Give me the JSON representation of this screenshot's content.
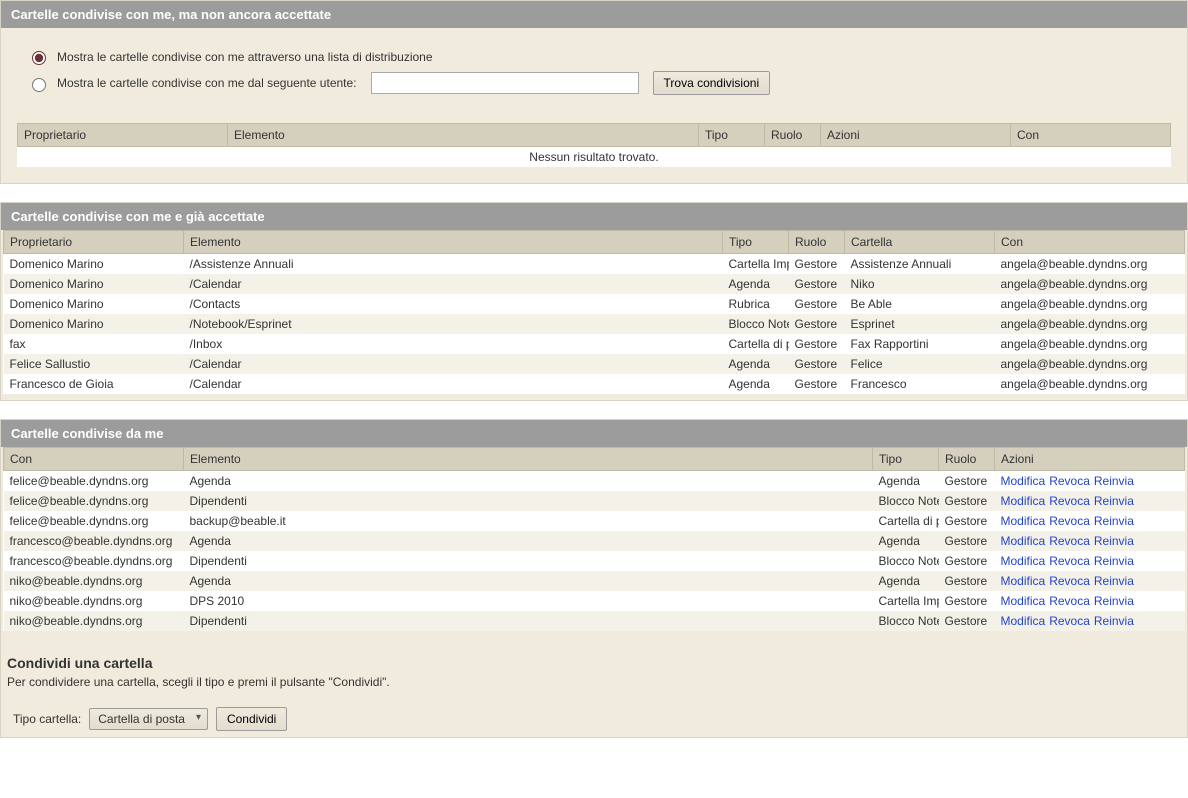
{
  "section1": {
    "title": "Cartelle condivise con me, ma non ancora accettate",
    "radio_dist_label": "Mostra le cartelle condivise con me attraverso una lista di distribuzione",
    "radio_user_label": "Mostra le cartelle condivise con me dal seguente utente:",
    "user_input_value": "",
    "find_button": "Trova condivisioni",
    "columns": {
      "proprietario": "Proprietario",
      "elemento": "Elemento",
      "tipo": "Tipo",
      "ruolo": "Ruolo",
      "azioni": "Azioni",
      "con": "Con"
    },
    "no_results": "Nessun risultato trovato."
  },
  "section2": {
    "title": "Cartelle condivise con me e già accettate",
    "columns": {
      "proprietario": "Proprietario",
      "elemento": "Elemento",
      "tipo": "Tipo",
      "ruolo": "Ruolo",
      "cartella": "Cartella",
      "con": "Con"
    },
    "rows": [
      {
        "proprietario": "Domenico Marino",
        "elemento": "/Assistenze Annuali",
        "tipo": "Cartella Imp",
        "ruolo": "Gestore",
        "cartella": "Assistenze Annuali",
        "con": "angela@beable.dyndns.org"
      },
      {
        "proprietario": "Domenico Marino",
        "elemento": "/Calendar",
        "tipo": "Agenda",
        "ruolo": "Gestore",
        "cartella": "Niko",
        "con": "angela@beable.dyndns.org"
      },
      {
        "proprietario": "Domenico Marino",
        "elemento": "/Contacts",
        "tipo": "Rubrica",
        "ruolo": "Gestore",
        "cartella": "Be Able",
        "con": "angela@beable.dyndns.org"
      },
      {
        "proprietario": "Domenico Marino",
        "elemento": "/Notebook/Esprinet",
        "tipo": "Blocco Note",
        "ruolo": "Gestore",
        "cartella": "Esprinet",
        "con": "angela@beable.dyndns.org"
      },
      {
        "proprietario": "fax",
        "elemento": "/Inbox",
        "tipo": "Cartella di p",
        "ruolo": "Gestore",
        "cartella": "Fax Rapportini",
        "con": "angela@beable.dyndns.org"
      },
      {
        "proprietario": "Felice Sallustio",
        "elemento": "/Calendar",
        "tipo": "Agenda",
        "ruolo": "Gestore",
        "cartella": "Felice",
        "con": "angela@beable.dyndns.org"
      },
      {
        "proprietario": "Francesco de Gioia",
        "elemento": "/Calendar",
        "tipo": "Agenda",
        "ruolo": "Gestore",
        "cartella": "Francesco",
        "con": "angela@beable.dyndns.org"
      }
    ]
  },
  "section3": {
    "title": "Cartelle condivise da me",
    "columns": {
      "con": "Con",
      "elemento": "Elemento",
      "tipo": "Tipo",
      "ruolo": "Ruolo",
      "azioni": "Azioni"
    },
    "actions": {
      "modifica": "Modifica",
      "revoca": "Revoca",
      "reinvia": "Reinvia"
    },
    "rows": [
      {
        "con": "felice@beable.dyndns.org",
        "elemento": "Agenda",
        "tipo": "Agenda",
        "ruolo": "Gestore"
      },
      {
        "con": "felice@beable.dyndns.org",
        "elemento": "Dipendenti",
        "tipo": "Blocco Note",
        "ruolo": "Gestore"
      },
      {
        "con": "felice@beable.dyndns.org",
        "elemento": "backup@beable.it",
        "tipo": "Cartella di p",
        "ruolo": "Gestore"
      },
      {
        "con": "francesco@beable.dyndns.org",
        "elemento": "Agenda",
        "tipo": "Agenda",
        "ruolo": "Gestore"
      },
      {
        "con": "francesco@beable.dyndns.org",
        "elemento": "Dipendenti",
        "tipo": "Blocco Note",
        "ruolo": "Gestore"
      },
      {
        "con": "niko@beable.dyndns.org",
        "elemento": "Agenda",
        "tipo": "Agenda",
        "ruolo": "Gestore"
      },
      {
        "con": "niko@beable.dyndns.org",
        "elemento": "DPS 2010",
        "tipo": "Cartella Imp",
        "ruolo": "Gestore"
      },
      {
        "con": "niko@beable.dyndns.org",
        "elemento": "Dipendenti",
        "tipo": "Blocco Note",
        "ruolo": "Gestore"
      }
    ],
    "share_heading": "Condividi una cartella",
    "share_help": "Per condividere una cartella, scegli il tipo e premi il pulsante \"Condividi\".",
    "share_type_label": "Tipo cartella:",
    "share_type_value": "Cartella di posta",
    "share_button": "Condividi"
  }
}
